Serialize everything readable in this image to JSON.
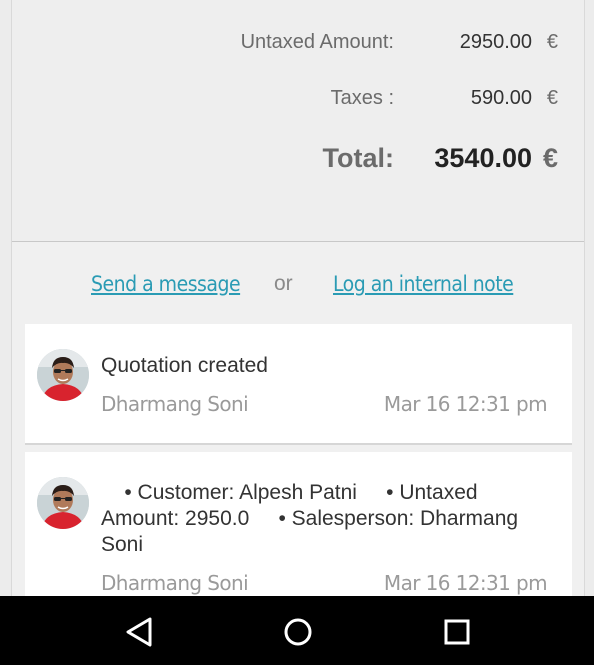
{
  "totals": {
    "untaxed_label": "Untaxed Amount:",
    "untaxed_value": "2950.00",
    "taxes_label": "Taxes :",
    "taxes_value": "590.00",
    "total_label": "Total:",
    "total_value": "3540.00",
    "currency": "€"
  },
  "chatter": {
    "send_message": "Send a message",
    "or": "or",
    "log_note": "Log an internal note"
  },
  "messages": [
    {
      "body": "Quotation created",
      "author": "Dharmang Soni",
      "date": "Mar 16 12:31 pm"
    },
    {
      "body": "    • Customer: Alpesh Patni     • Untaxed Amount: 2950.0     • Salesperson: Dharmang Soni",
      "author": "Dharmang Soni",
      "date": "Mar 16 12:31 pm"
    }
  ],
  "navbar": {
    "icons": [
      "back-icon",
      "home-icon",
      "recents-icon"
    ]
  },
  "colors": {
    "link": "#2a9bb4",
    "background": "#f0f0f0",
    "navbar": "#000000"
  }
}
